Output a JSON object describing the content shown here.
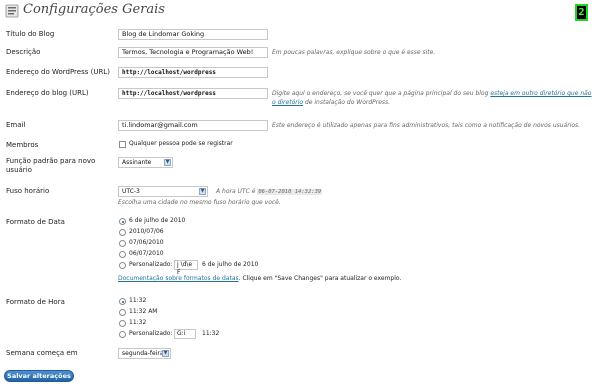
{
  "page": {
    "title": "Configurações Gerais",
    "badge": "2"
  },
  "fields": {
    "blog_title": {
      "label": "Título do Blog",
      "value": "Blog de Lindomar Goking"
    },
    "tagline": {
      "label": "Descrição",
      "value": "Termos, Tecnologia e Programação Web!",
      "description": "Em poucas palavras, explique sobre o que é esse site."
    },
    "wp_address": {
      "label": "Endereço do WordPress (URL)",
      "value": "http://localhost/wordpress"
    },
    "blog_address": {
      "label": "Endereço do blog (URL)",
      "value": "http://localhost/wordpress",
      "description_prefix": "Digite aqui o endereço, se você quer que a página principal do seu blog ",
      "description_link": "esteja em outro diretório que não o diretório",
      "description_suffix": " de instalação do WordPress."
    },
    "email": {
      "label": "Email",
      "value": "ti.lindomar@gmail.com",
      "description": "Este endereço é utilizado apenas para fins administrativos, tais como a notificação de novos usuários."
    },
    "membership": {
      "label": "Membros",
      "checkbox_label": "Qualquer pessoa pode se registrar",
      "checked": false
    },
    "default_role": {
      "label": "Função padrão para novo usuário",
      "value": "Assinante"
    },
    "timezone": {
      "label": "Fuso horário",
      "value": "UTC-3",
      "utc_prefix": "A hora UTC é",
      "utc_time": "06-07-2010 14:32:39",
      "description": "Escolha uma cidade no mesmo fuso horário que você."
    },
    "date_format": {
      "label": "Formato de Data",
      "options": [
        {
          "text": "6 de julho de 2010",
          "selected": true
        },
        {
          "text": "2010/07/06",
          "selected": false
        },
        {
          "text": "07/06/2010",
          "selected": false
        },
        {
          "text": "06/07/2010",
          "selected": false
        }
      ],
      "custom_label": "Personalizado:",
      "custom_value": "j \\d\\e F",
      "custom_preview": "6 de julho de 2010",
      "doc_link": "Documentação sobre formatos de datas",
      "doc_suffix": ". Clique em \"Save Changes\" para atualizar o exemplo."
    },
    "time_format": {
      "label": "Formato de Hora",
      "options": [
        {
          "text": "11:32",
          "selected": true
        },
        {
          "text": "11:32 AM",
          "selected": false
        },
        {
          "text": "11:32",
          "selected": false
        }
      ],
      "custom_label": "Personalizado:",
      "custom_value": "G:i",
      "custom_preview": "11:32"
    },
    "start_of_week": {
      "label": "Semana começa em",
      "value": "segunda-feira"
    }
  },
  "save_button": "Salvar alterações",
  "colors": {
    "accent": "#21759b",
    "button": "#21639f",
    "badge_green": "#21d421"
  },
  "icons": {
    "page": "settings-page-icon",
    "dropdown": "chevron-down-icon"
  }
}
